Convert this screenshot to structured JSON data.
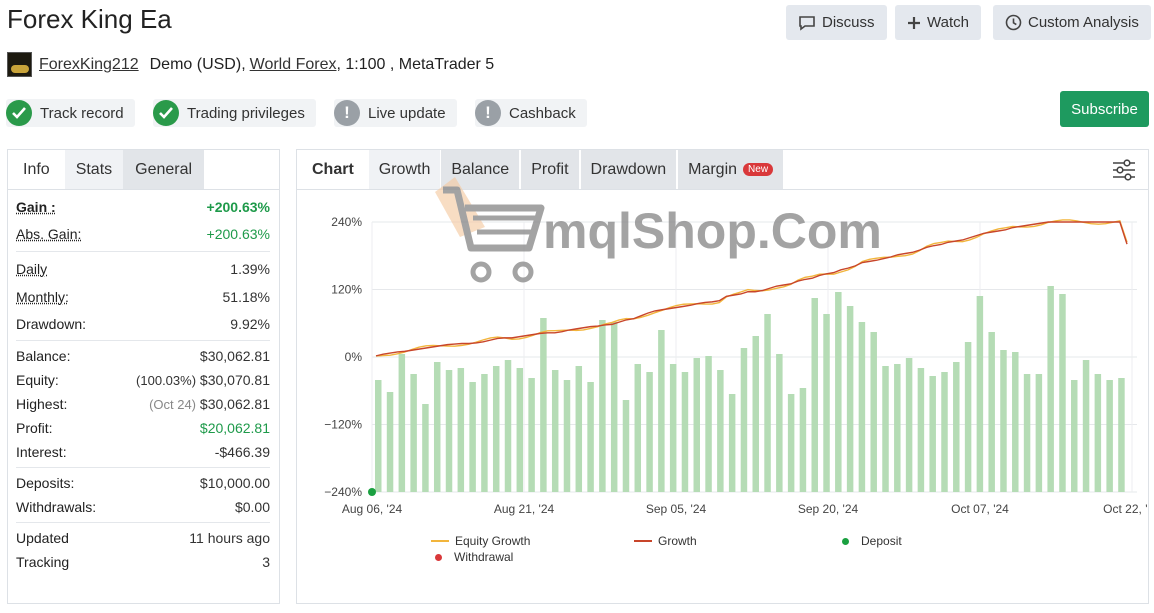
{
  "header": {
    "title": "Forex King Ea",
    "buttons": {
      "discuss": "Discuss",
      "watch": "Watch",
      "custom_analysis": "Custom Analysis"
    }
  },
  "account": {
    "username": "ForexKing212",
    "type": "Demo (USD),",
    "broker": "World Forex",
    "details": ", 1:100 , MetaTrader 5"
  },
  "badges": [
    {
      "label": "Track record",
      "status": "ok"
    },
    {
      "label": "Trading privileges",
      "status": "ok"
    },
    {
      "label": "Live update",
      "status": "warn"
    },
    {
      "label": "Cashback",
      "status": "warn"
    }
  ],
  "subscribe_label": "Subscribe",
  "left_tabs": {
    "info": "Info",
    "stats": "Stats",
    "general": "General"
  },
  "stats": {
    "gain": {
      "label": "Gain :",
      "value": "+200.63%"
    },
    "abs_gain": {
      "label": "Abs. Gain:",
      "value": "+200.63%"
    },
    "daily": {
      "label": "Daily",
      "value": "1.39%"
    },
    "monthly": {
      "label": "Monthly:",
      "value": "51.18%"
    },
    "drawdown": {
      "label": "Drawdown:",
      "value": "9.92%"
    },
    "balance": {
      "label": "Balance:",
      "value": "$30,062.81"
    },
    "equity": {
      "label": "Equity:",
      "note": "(100.03%)",
      "value": "$30,070.81"
    },
    "highest": {
      "label": "Highest:",
      "note": "(Oct 24)",
      "value": "$30,062.81"
    },
    "profit": {
      "label": "Profit:",
      "value": "$20,062.81"
    },
    "interest": {
      "label": "Interest:",
      "value": "-$466.39"
    },
    "deposits": {
      "label": "Deposits:",
      "value": "$10,000.00"
    },
    "withdrawals": {
      "label": "Withdrawals:",
      "value": "$0.00"
    },
    "updated": {
      "label": "Updated",
      "value": "11 hours ago"
    },
    "tracking": {
      "label": "Tracking",
      "value": "3"
    }
  },
  "chart_tabs": {
    "chart": "Chart",
    "growth": "Growth",
    "balance": "Balance",
    "profit": "Profit",
    "drawdown": "Drawdown",
    "margin": "Margin",
    "new_badge": "New"
  },
  "watermark_text": "mqlShop.Com",
  "colors": {
    "accent_green": "#1e9a5f",
    "bar": "#b5dcb5",
    "equity_line": "#f2b53c",
    "growth_line": "#c8452a",
    "deposit": "#1aa040",
    "withdrawal": "#d9383a"
  },
  "chart_data": {
    "type": "line",
    "y_ticks": [
      "240%",
      "120%",
      "0%",
      "−120%",
      "−240%"
    ],
    "ylim": [
      -240,
      240
    ],
    "x_ticks": [
      "Aug 06, '24",
      "Aug 21, '24",
      "Sep 05, '24",
      "Sep 20, '24",
      "Oct 07, '24",
      "Oct 22, '24"
    ],
    "grid": true,
    "legend": {
      "position": "bottom",
      "equity": "Equity Growth",
      "growth": "Growth",
      "deposit": "Deposit",
      "withdrawal": "Withdrawal"
    },
    "growth": [
      2,
      5,
      7,
      9,
      10,
      12,
      14,
      16,
      18,
      20,
      22,
      23,
      24,
      24,
      25,
      27,
      30,
      33,
      34,
      34,
      36,
      38,
      40,
      42,
      43,
      43,
      45,
      48,
      50,
      52,
      54,
      55,
      57,
      58,
      62,
      66,
      68,
      73,
      78,
      82,
      84,
      86,
      88,
      90,
      92,
      95,
      97,
      98,
      100,
      108,
      110,
      112,
      116,
      116,
      118,
      122,
      126,
      128,
      130,
      135,
      138,
      140,
      145,
      148,
      150,
      155,
      158,
      162,
      168,
      170,
      172,
      175,
      178,
      182,
      184,
      186,
      190,
      195,
      198,
      200,
      204,
      206,
      208,
      212,
      216,
      220,
      222,
      224,
      226,
      230,
      232,
      234,
      236,
      238,
      240,
      240,
      240,
      240,
      240,
      240,
      240,
      240,
      240,
      240,
      240,
      200.63
    ],
    "bars_note": "daily growth bars (secondary scale)",
    "bars": [
      112,
      100,
      138,
      118,
      88,
      130,
      122,
      124,
      110,
      118,
      126,
      132,
      124,
      114,
      174,
      122,
      112,
      126,
      110,
      172,
      170,
      92,
      128,
      120,
      162,
      128,
      120,
      134,
      136,
      122,
      98,
      144,
      156,
      178,
      138,
      98,
      104,
      194,
      178,
      200,
      186,
      170,
      160,
      126,
      128,
      134,
      124,
      116,
      120,
      130,
      150,
      196,
      160,
      142,
      140,
      118,
      118,
      206,
      198,
      112,
      132,
      118,
      112,
      114
    ]
  }
}
